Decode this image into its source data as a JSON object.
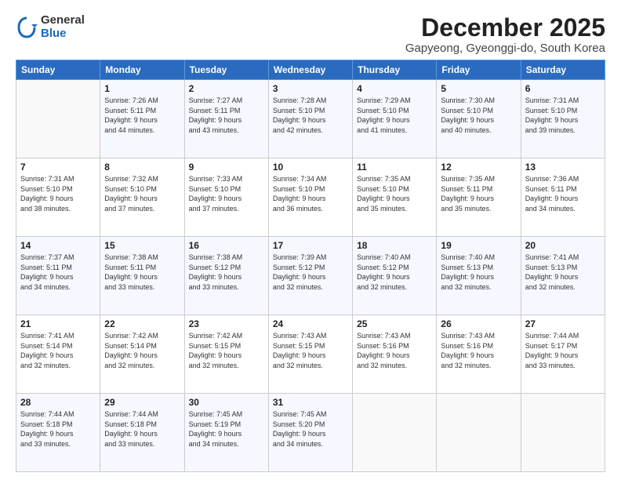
{
  "header": {
    "logo_general": "General",
    "logo_blue": "Blue",
    "month_title": "December 2025",
    "location": "Gapyeong, Gyeonggi-do, South Korea"
  },
  "days_of_week": [
    "Sunday",
    "Monday",
    "Tuesday",
    "Wednesday",
    "Thursday",
    "Friday",
    "Saturday"
  ],
  "weeks": [
    [
      {
        "day": "",
        "text": ""
      },
      {
        "day": "1",
        "text": "Sunrise: 7:26 AM\nSunset: 5:11 PM\nDaylight: 9 hours\nand 44 minutes."
      },
      {
        "day": "2",
        "text": "Sunrise: 7:27 AM\nSunset: 5:11 PM\nDaylight: 9 hours\nand 43 minutes."
      },
      {
        "day": "3",
        "text": "Sunrise: 7:28 AM\nSunset: 5:10 PM\nDaylight: 9 hours\nand 42 minutes."
      },
      {
        "day": "4",
        "text": "Sunrise: 7:29 AM\nSunset: 5:10 PM\nDaylight: 9 hours\nand 41 minutes."
      },
      {
        "day": "5",
        "text": "Sunrise: 7:30 AM\nSunset: 5:10 PM\nDaylight: 9 hours\nand 40 minutes."
      },
      {
        "day": "6",
        "text": "Sunrise: 7:31 AM\nSunset: 5:10 PM\nDaylight: 9 hours\nand 39 minutes."
      }
    ],
    [
      {
        "day": "7",
        "text": "Sunrise: 7:31 AM\nSunset: 5:10 PM\nDaylight: 9 hours\nand 38 minutes."
      },
      {
        "day": "8",
        "text": "Sunrise: 7:32 AM\nSunset: 5:10 PM\nDaylight: 9 hours\nand 37 minutes."
      },
      {
        "day": "9",
        "text": "Sunrise: 7:33 AM\nSunset: 5:10 PM\nDaylight: 9 hours\nand 37 minutes."
      },
      {
        "day": "10",
        "text": "Sunrise: 7:34 AM\nSunset: 5:10 PM\nDaylight: 9 hours\nand 36 minutes."
      },
      {
        "day": "11",
        "text": "Sunrise: 7:35 AM\nSunset: 5:10 PM\nDaylight: 9 hours\nand 35 minutes."
      },
      {
        "day": "12",
        "text": "Sunrise: 7:35 AM\nSunset: 5:11 PM\nDaylight: 9 hours\nand 35 minutes."
      },
      {
        "day": "13",
        "text": "Sunrise: 7:36 AM\nSunset: 5:11 PM\nDaylight: 9 hours\nand 34 minutes."
      }
    ],
    [
      {
        "day": "14",
        "text": "Sunrise: 7:37 AM\nSunset: 5:11 PM\nDaylight: 9 hours\nand 34 minutes."
      },
      {
        "day": "15",
        "text": "Sunrise: 7:38 AM\nSunset: 5:11 PM\nDaylight: 9 hours\nand 33 minutes."
      },
      {
        "day": "16",
        "text": "Sunrise: 7:38 AM\nSunset: 5:12 PM\nDaylight: 9 hours\nand 33 minutes."
      },
      {
        "day": "17",
        "text": "Sunrise: 7:39 AM\nSunset: 5:12 PM\nDaylight: 9 hours\nand 32 minutes."
      },
      {
        "day": "18",
        "text": "Sunrise: 7:40 AM\nSunset: 5:12 PM\nDaylight: 9 hours\nand 32 minutes."
      },
      {
        "day": "19",
        "text": "Sunrise: 7:40 AM\nSunset: 5:13 PM\nDaylight: 9 hours\nand 32 minutes."
      },
      {
        "day": "20",
        "text": "Sunrise: 7:41 AM\nSunset: 5:13 PM\nDaylight: 9 hours\nand 32 minutes."
      }
    ],
    [
      {
        "day": "21",
        "text": "Sunrise: 7:41 AM\nSunset: 5:14 PM\nDaylight: 9 hours\nand 32 minutes."
      },
      {
        "day": "22",
        "text": "Sunrise: 7:42 AM\nSunset: 5:14 PM\nDaylight: 9 hours\nand 32 minutes."
      },
      {
        "day": "23",
        "text": "Sunrise: 7:42 AM\nSunset: 5:15 PM\nDaylight: 9 hours\nand 32 minutes."
      },
      {
        "day": "24",
        "text": "Sunrise: 7:43 AM\nSunset: 5:15 PM\nDaylight: 9 hours\nand 32 minutes."
      },
      {
        "day": "25",
        "text": "Sunrise: 7:43 AM\nSunset: 5:16 PM\nDaylight: 9 hours\nand 32 minutes."
      },
      {
        "day": "26",
        "text": "Sunrise: 7:43 AM\nSunset: 5:16 PM\nDaylight: 9 hours\nand 32 minutes."
      },
      {
        "day": "27",
        "text": "Sunrise: 7:44 AM\nSunset: 5:17 PM\nDaylight: 9 hours\nand 33 minutes."
      }
    ],
    [
      {
        "day": "28",
        "text": "Sunrise: 7:44 AM\nSunset: 5:18 PM\nDaylight: 9 hours\nand 33 minutes."
      },
      {
        "day": "29",
        "text": "Sunrise: 7:44 AM\nSunset: 5:18 PM\nDaylight: 9 hours\nand 33 minutes."
      },
      {
        "day": "30",
        "text": "Sunrise: 7:45 AM\nSunset: 5:19 PM\nDaylight: 9 hours\nand 34 minutes."
      },
      {
        "day": "31",
        "text": "Sunrise: 7:45 AM\nSunset: 5:20 PM\nDaylight: 9 hours\nand 34 minutes."
      },
      {
        "day": "",
        "text": ""
      },
      {
        "day": "",
        "text": ""
      },
      {
        "day": "",
        "text": ""
      }
    ]
  ]
}
